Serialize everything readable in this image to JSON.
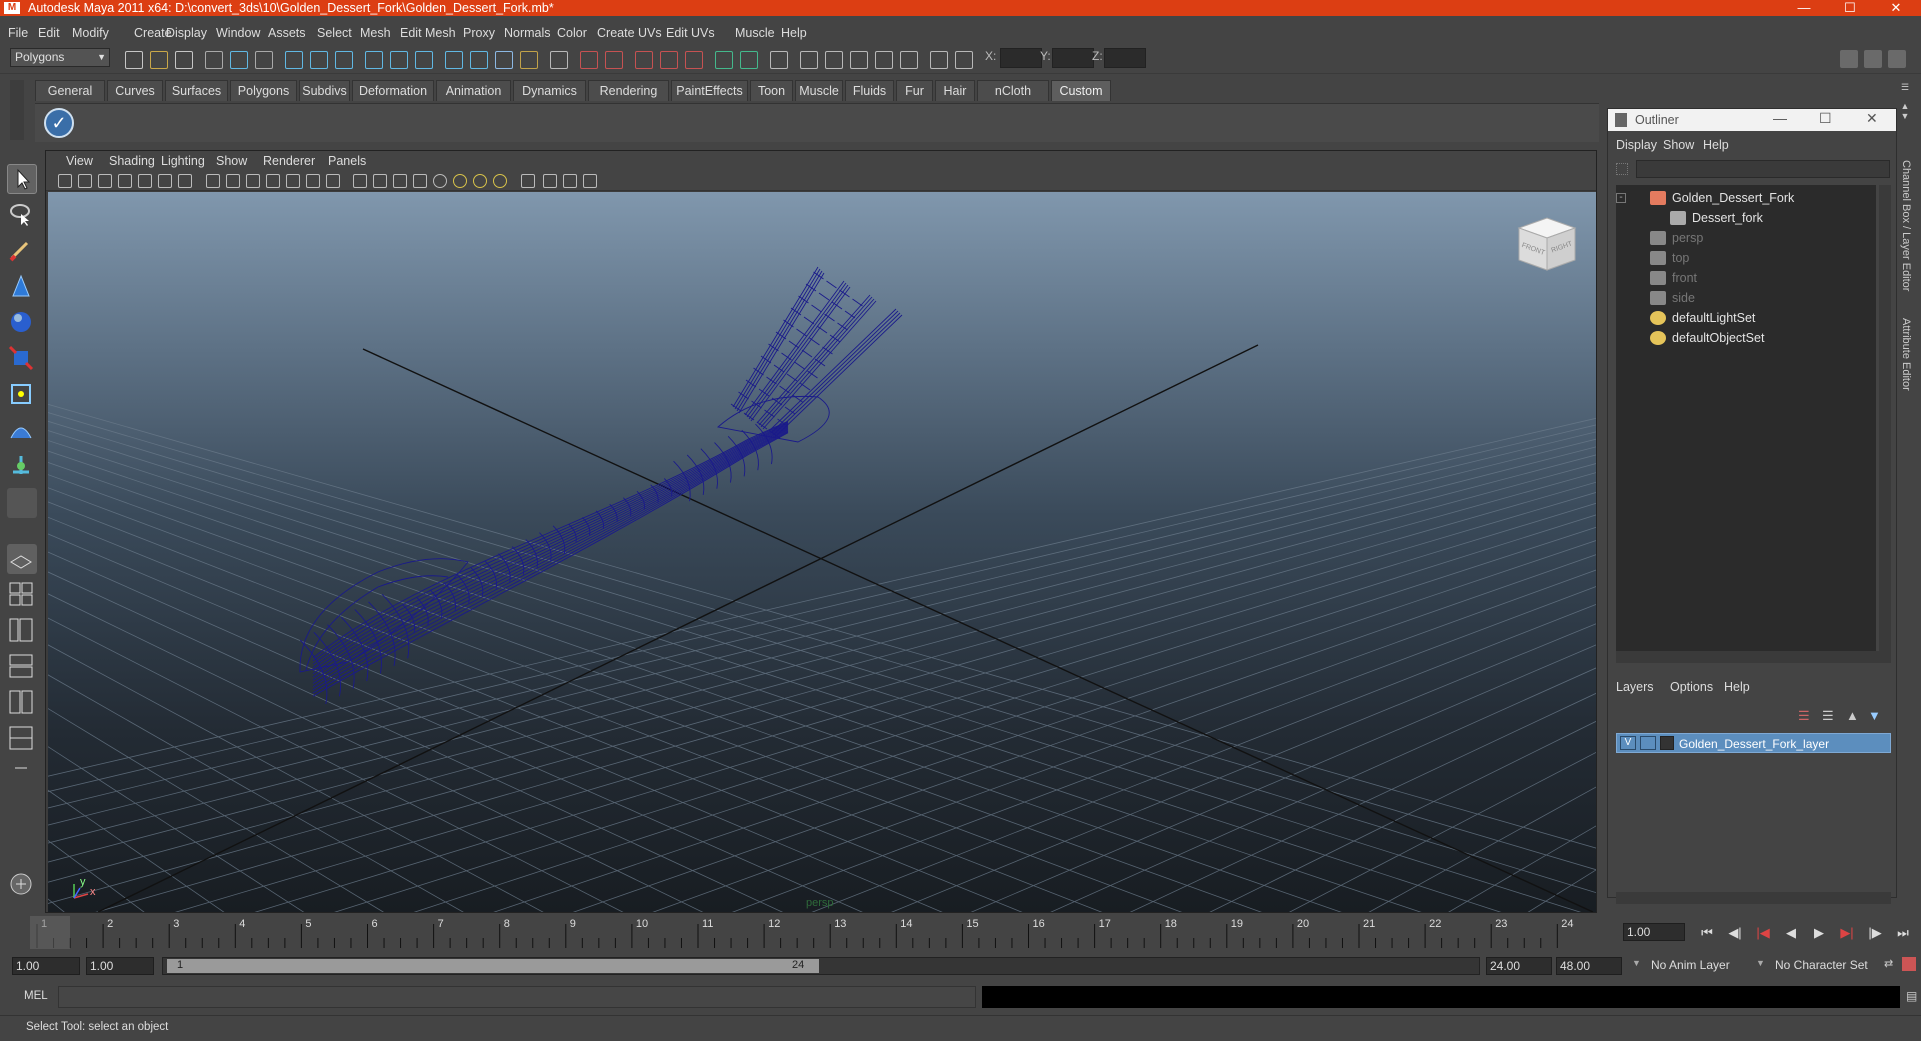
{
  "window": {
    "title": "Autodesk Maya 2011 x64: D:\\convert_3ds\\10\\Golden_Dessert_Fork\\Golden_Dessert_Fork.mb*",
    "app_icon_label": "M"
  },
  "menubar": [
    "File",
    "Edit",
    "Modify",
    "Create",
    "Display",
    "Window",
    "Assets",
    "Select",
    "Mesh",
    "Edit Mesh",
    "Proxy",
    "Normals",
    "Color",
    "Create UVs",
    "Edit UVs",
    "Muscle",
    "Help"
  ],
  "statusline": {
    "mode": "Polygons",
    "x_label": "X:",
    "y_label": "Y:",
    "z_label": "Z:"
  },
  "shelf_tabs": [
    "General",
    "Curves",
    "Surfaces",
    "Polygons",
    "Subdivs",
    "Deformation",
    "Animation",
    "Dynamics",
    "Rendering",
    "PaintEffects",
    "Toon",
    "Muscle",
    "Fluids",
    "Fur",
    "Hair",
    "nCloth",
    "Custom"
  ],
  "active_shelf_tab": "Custom",
  "viewport": {
    "menu": [
      "View",
      "Shading",
      "Lighting",
      "Show",
      "Renderer",
      "Panels"
    ],
    "camera_label": "persp",
    "viewcube": {
      "front": "FRONT",
      "right": "RIGHT"
    },
    "axis_x": "x",
    "axis_y": "y"
  },
  "outliner": {
    "title": "Outliner",
    "menu": [
      "Display",
      "Show",
      "Help"
    ],
    "items": [
      {
        "label": "Golden_Dessert_Fork",
        "dim": false
      },
      {
        "label": "Dessert_fork",
        "dim": false
      },
      {
        "label": "persp",
        "dim": true
      },
      {
        "label": "top",
        "dim": true
      },
      {
        "label": "front",
        "dim": true
      },
      {
        "label": "side",
        "dim": true
      },
      {
        "label": "defaultLightSet",
        "dim": false
      },
      {
        "label": "defaultObjectSet",
        "dim": false
      }
    ]
  },
  "layers": {
    "menu": [
      "Layers",
      "Options",
      "Help"
    ],
    "layer_name": "Golden_Dessert_Fork_layer",
    "visibility": "V"
  },
  "side_tabs": [
    "Channel Box / Layer Editor",
    "Attribute Editor"
  ],
  "timeline": {
    "ticks": [
      "1",
      "2",
      "3",
      "4",
      "5",
      "6",
      "7",
      "8",
      "9",
      "10",
      "11",
      "12",
      "13",
      "14",
      "15",
      "16",
      "17",
      "18",
      "19",
      "20",
      "21",
      "22",
      "23",
      "24"
    ],
    "current_frame": "1.00",
    "range_start": "1.00",
    "range_start2": "1.00",
    "slider_start": "1",
    "slider_end": "24",
    "range_end": "24.00",
    "anim_end": "48.00",
    "anim_layer": "No Anim Layer",
    "character_set": "No Character Set"
  },
  "command": {
    "label": "MEL"
  },
  "help_line": "Select Tool: select an object"
}
